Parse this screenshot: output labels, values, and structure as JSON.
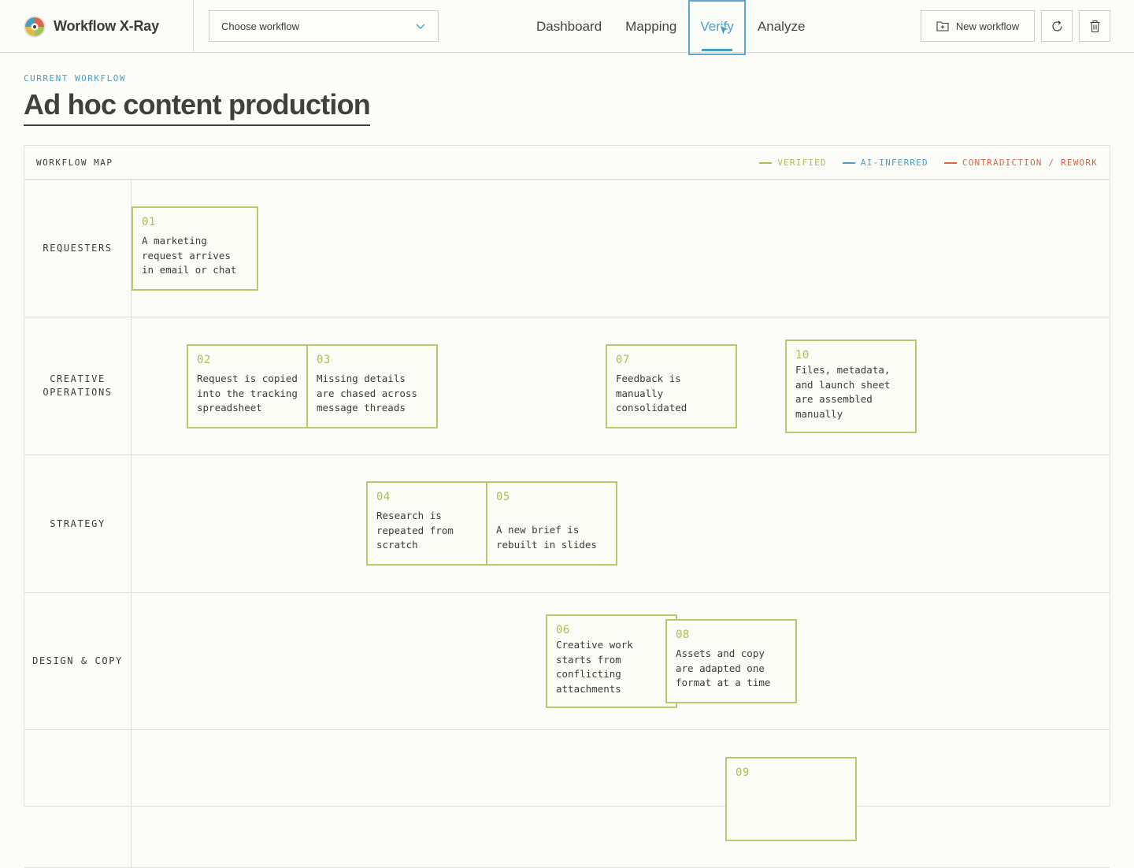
{
  "app": {
    "name": "Workflow X-Ray"
  },
  "workflow_select": {
    "value": "Choose workflow"
  },
  "nav": {
    "tabs": [
      {
        "label": "Dashboard",
        "active": false
      },
      {
        "label": "Mapping",
        "active": false
      },
      {
        "label": "Verify",
        "active": true
      },
      {
        "label": "Analyze",
        "active": false
      }
    ]
  },
  "actions": {
    "new_workflow": "New workflow",
    "refresh_icon": "refresh-icon",
    "delete_icon": "trash-icon"
  },
  "page": {
    "eyebrow": "CURRENT WORKFLOW",
    "title": "Ad hoc content production"
  },
  "map": {
    "title": "WORKFLOW MAP",
    "legend": [
      {
        "label": "VERIFIED",
        "color": "#a7c15a"
      },
      {
        "label": "AI-INFERRED",
        "color": "#4a9ec6"
      },
      {
        "label": "CONTRADICTION / REWORK",
        "color": "#d9654a"
      }
    ],
    "lanes": [
      {
        "label": "REQUESTERS"
      },
      {
        "label": "CREATIVE OPERATIONS"
      },
      {
        "label": "STRATEGY"
      },
      {
        "label": "DESIGN & COPY"
      },
      {
        "label": ""
      }
    ],
    "steps": [
      {
        "num": "01",
        "text": "A marketing request arrives in email or chat"
      },
      {
        "num": "02",
        "text": "Request is copied into the tracking spreadsheet"
      },
      {
        "num": "03",
        "text": "Missing details are chased across message threads"
      },
      {
        "num": "04",
        "text": "Research is repeated from scratch"
      },
      {
        "num": "05",
        "text": "A new brief is rebuilt in slides"
      },
      {
        "num": "06",
        "text": "Creative work starts from conflicting attachments"
      },
      {
        "num": "07",
        "text": "Feedback is manually consolidated"
      },
      {
        "num": "08",
        "text": "Assets and copy are adapted one format at a time"
      },
      {
        "num": "09",
        "text": ""
      },
      {
        "num": "10",
        "text": "Files, metadata, and launch sheet are assembled manually"
      }
    ]
  },
  "colors": {
    "accent": "#4a9ec6",
    "verified": "#a7c15a",
    "rework": "#d9654a"
  }
}
